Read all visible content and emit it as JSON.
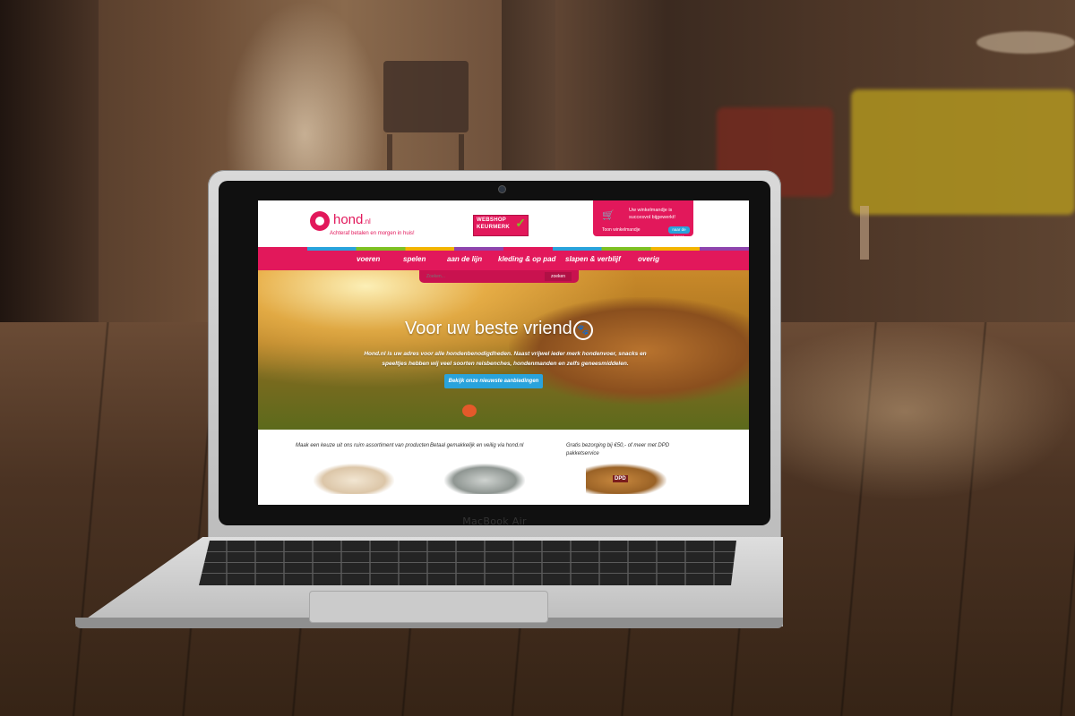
{
  "device": {
    "brand_label": "MacBook Air"
  },
  "site": {
    "logo": {
      "name": "hond",
      "tld": ".nl",
      "tagline": "Achteraf betalen en morgen in huis!"
    },
    "keurmerk": {
      "line1": "WEBSHOP",
      "line2": "KEURMERK"
    },
    "cart": {
      "message": "Uw winkelmandje is succesvol bijgewerkt!",
      "view_link": "Toon winkelmandje",
      "button": "naar de kassa"
    },
    "nav": {
      "items": [
        {
          "label": "voeren"
        },
        {
          "label": "spelen"
        },
        {
          "label": "aan de lijn"
        },
        {
          "label": "kleding & op pad"
        },
        {
          "label": "slapen & verblijf"
        },
        {
          "label": "overig"
        }
      ]
    },
    "search": {
      "placeholder": "Zoeken...",
      "button": "zoeken"
    },
    "hero": {
      "title": "Voor uw beste vriend",
      "text": "Hond.nl is uw adres voor alle hondenbenodigdheden. Naast vrijwel ieder merk hondenvoer, snacks en speeltjes hebben wij veel soorten reisbenches, hondenmanden en zelfs geneesmiddelen.",
      "button": "Bekijk onze nieuwste aanbiedingen"
    },
    "features": [
      {
        "text": "Maak een keuze uit ons ruim assortiment van producten"
      },
      {
        "text": "Betaal gemakkelijk en veilig via hond.nl"
      },
      {
        "text": "Gratis bezorging bij €50,- of meer met DPD pakketservice"
      }
    ],
    "box_label": "DPD"
  },
  "colors": {
    "brand_pink": "#e2185b",
    "accent_blue": "#29a3dc",
    "check_green": "#7ec022"
  }
}
